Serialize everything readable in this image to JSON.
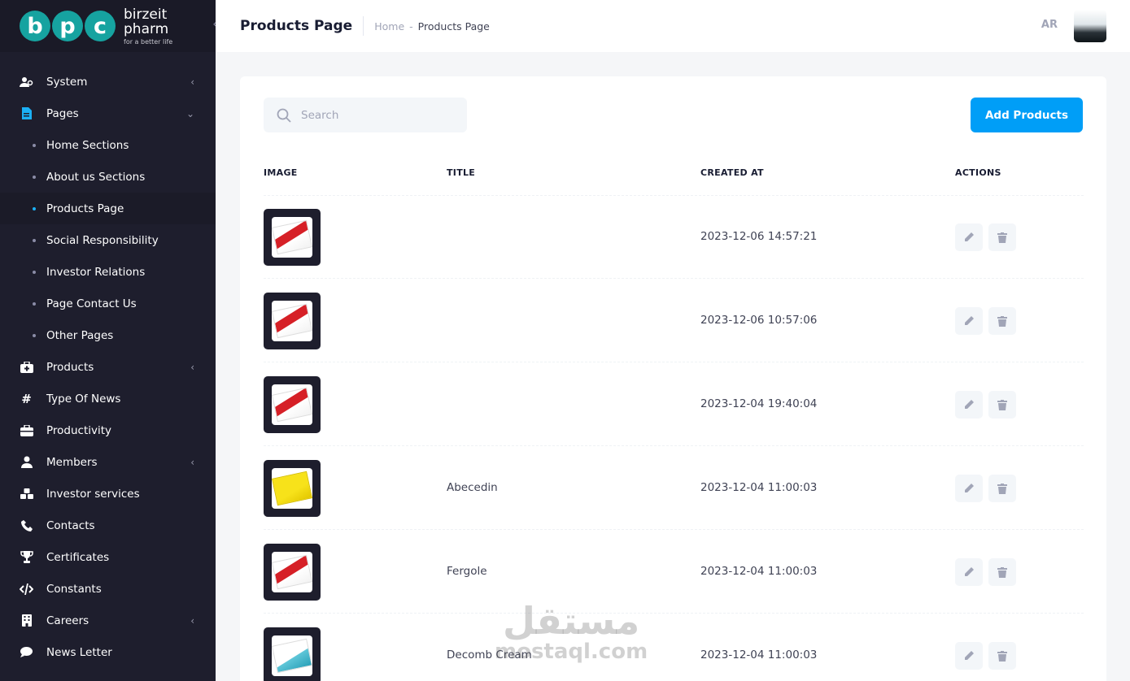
{
  "brand": {
    "logo_letters": [
      "b",
      "p",
      "c"
    ],
    "name": "birzeit pharm",
    "tagline": "for a better life"
  },
  "sidebar": {
    "items": [
      {
        "label": "System",
        "icon": "users-cog-icon",
        "has_chevron": true
      },
      {
        "label": "Pages",
        "icon": "file-icon",
        "expanded": true
      },
      {
        "label": "Products",
        "icon": "medkit-icon",
        "has_chevron": true
      },
      {
        "label": "Type Of News",
        "icon": "hashtag-icon",
        "has_chevron": false
      },
      {
        "label": "Productivity",
        "icon": "briefcase-icon",
        "has_chevron": false
      },
      {
        "label": "Members",
        "icon": "user-icon",
        "has_chevron": true
      },
      {
        "label": "Investor services",
        "icon": "cubes-icon",
        "has_chevron": false
      },
      {
        "label": "Contacts",
        "icon": "phone-icon",
        "has_chevron": false
      },
      {
        "label": "Certificates",
        "icon": "trophy-icon",
        "has_chevron": false
      },
      {
        "label": "Constants",
        "icon": "code-icon",
        "has_chevron": false
      },
      {
        "label": "Careers",
        "icon": "building-icon",
        "has_chevron": true
      },
      {
        "label": "News Letter",
        "icon": "comment-icon",
        "has_chevron": false
      }
    ],
    "pages_sub": [
      "Home Sections",
      "About us Sections",
      "Products Page",
      "Social Responsibility",
      "Investor Relations",
      "Page Contact Us",
      "Other Pages"
    ],
    "active_sub": "Products Page"
  },
  "header": {
    "title": "Products Page",
    "breadcrumb_home": "Home",
    "breadcrumb_sep": "-",
    "breadcrumb_current": "Products Page",
    "language": "AR"
  },
  "toolbar": {
    "search_placeholder": "Search",
    "add_label": "Add Products"
  },
  "table": {
    "columns": [
      "IMAGE",
      "TITLE",
      "CREATED AT",
      "ACTIONS"
    ],
    "rows": [
      {
        "image": "red",
        "title": "",
        "created_at": "2023-12-06 14:57:21"
      },
      {
        "image": "red",
        "title": "",
        "created_at": "2023-12-06 10:57:06"
      },
      {
        "image": "red",
        "title": "",
        "created_at": "2023-12-04 19:40:04"
      },
      {
        "image": "yellow",
        "title": "Abecedin",
        "created_at": "2023-12-04 11:00:03"
      },
      {
        "image": "red",
        "title": "Fergole",
        "created_at": "2023-12-04 11:00:03"
      },
      {
        "image": "white",
        "title": "Decomb Cream",
        "created_at": "2023-12-04 11:00:03"
      }
    ]
  },
  "watermark": {
    "arabic": "مستقل",
    "latin": "mostaql.com"
  },
  "colors": {
    "sidebar_bg": "#1e1e2d",
    "accent": "#009ef7",
    "brand_teal": "#16a3a0"
  }
}
